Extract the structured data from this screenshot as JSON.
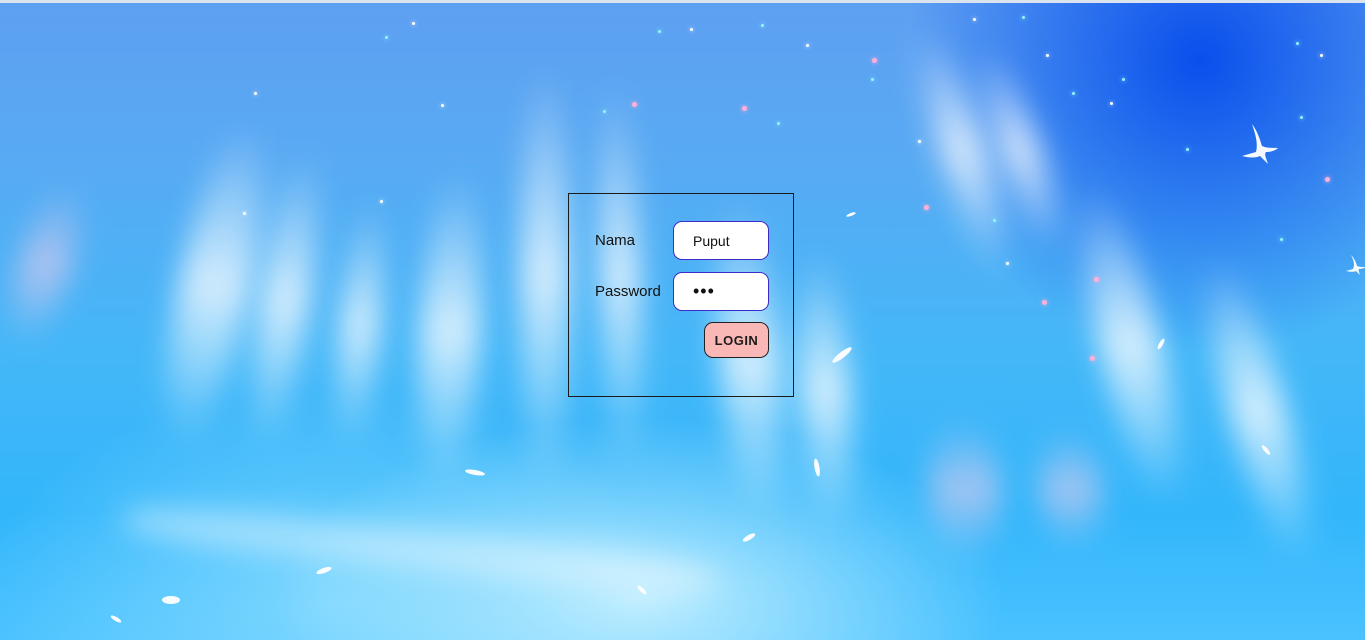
{
  "login_form": {
    "name_label": "Nama",
    "name_value": "Puput",
    "password_label": "Password",
    "password_value": "abc",
    "submit_label": "LOGIN"
  },
  "colors": {
    "input_border": "#3b2cc9",
    "button_background": "#f9b7b5",
    "panel_border": "#1a1a1a",
    "background_sky": "#33b6fb"
  },
  "background": {
    "description_icon": "aurora-sky-background"
  }
}
